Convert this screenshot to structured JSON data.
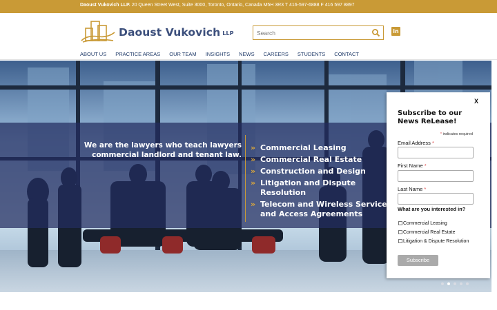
{
  "topbar": {
    "firm": "Daoust Vukovich LLP.",
    "details": " 20 Queen Street West, Suite 3000, Toronto, Ontario, Canada M5H 3R3 T 416-597-6888 F 416 597 8897"
  },
  "header": {
    "logo_name": "Daoust Vukovich",
    "logo_suffix": "LLP",
    "search_placeholder": "Search",
    "social_label": "in"
  },
  "nav": {
    "items": [
      {
        "label": "ABOUT US"
      },
      {
        "label": "PRACTICE AREAS"
      },
      {
        "label": "OUR TEAM"
      },
      {
        "label": "INSIGHTS"
      },
      {
        "label": "NEWS"
      },
      {
        "label": "CAREERS"
      },
      {
        "label": "STUDENTS"
      },
      {
        "label": "CONTACT"
      }
    ]
  },
  "hero": {
    "tagline_line1": "We are the lawyers who teach lawyers",
    "tagline_line2": "commercial landlord and tenant law.",
    "areas": [
      {
        "label": "Commercial Leasing"
      },
      {
        "label": "Commercial Real Estate"
      },
      {
        "label": "Construction and Design"
      },
      {
        "label": "Litigation and Dispute Resolution"
      },
      {
        "label": "Telecom and Wireless Service and Access Agreements"
      }
    ],
    "chevron": "»",
    "slide_count": 5,
    "active_slide": 2
  },
  "popup": {
    "close": "X",
    "title": "Subscribe to our News ReLease!",
    "required_mark": "*",
    "required_note": "indicates required",
    "fields": [
      {
        "label": "Email Address",
        "value": ""
      },
      {
        "label": "First Name",
        "value": ""
      },
      {
        "label": "Last Name",
        "value": ""
      }
    ],
    "interest_label": "What are you interested in?",
    "options": [
      {
        "label": "Commercial Leasing",
        "checked": false
      },
      {
        "label": "Commercial Real Estate",
        "checked": false
      },
      {
        "label": "Litigation & Dispute Resolution",
        "checked": false
      }
    ],
    "submit": "Subscribe"
  },
  "colors": {
    "accent_gold": "#c99a36",
    "nav_blue": "#1f3a68",
    "logo_blue": "#3c4f7c",
    "band_overlay": "rgba(35,45,95,0.72)"
  }
}
